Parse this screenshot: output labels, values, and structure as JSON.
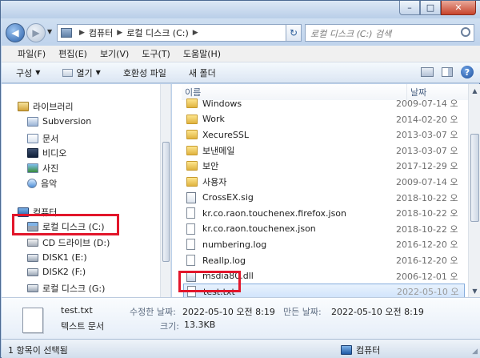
{
  "window": {
    "minimize": "–",
    "maximize": "□",
    "close": "✕"
  },
  "address": {
    "crumbs": [
      "컴퓨터",
      "로컬 디스크 (C:)"
    ],
    "search_placeholder": "로컬 디스크 (C:) 검색"
  },
  "menu": [
    "파일(F)",
    "편집(E)",
    "보기(V)",
    "도구(T)",
    "도움말(H)"
  ],
  "commands": {
    "organize": "구성",
    "open": "열기",
    "compat": "호환성 파일",
    "new_folder": "새 폴더"
  },
  "nav": {
    "libraries": "라이브러리",
    "lib_items": [
      "Subversion",
      "문서",
      "비디오",
      "사진",
      "음악"
    ],
    "computer": "컴퓨터",
    "drives": [
      "로컬 디스크 (C:)",
      "CD 드라이브 (D:)",
      "DISK1 (E:)",
      "DISK2 (F:)",
      "로컬 디스크 (G:)"
    ]
  },
  "list": {
    "col_name": "이름",
    "col_date": "날짜",
    "rows": [
      {
        "name": "Windows",
        "date": "2009-07-14 오",
        "icon": "folder-icon"
      },
      {
        "name": "Work",
        "date": "2014-02-20 오",
        "icon": "folder-icon"
      },
      {
        "name": "XecureSSL",
        "date": "2013-03-07 오",
        "icon": "folder-icon"
      },
      {
        "name": "보낸메일",
        "date": "2013-03-07 오",
        "icon": "folder-icon"
      },
      {
        "name": "보안",
        "date": "2017-12-29 오",
        "icon": "folder-icon"
      },
      {
        "name": "사용자",
        "date": "2009-07-14 오",
        "icon": "folder-icon"
      },
      {
        "name": "CrossEX.sig",
        "date": "2018-10-22 오",
        "icon": "certificate-icon"
      },
      {
        "name": "kr.co.raon.touchenex.firefox.json",
        "date": "2018-10-22 오",
        "icon": "file-icon"
      },
      {
        "name": "kr.co.raon.touchenex.json",
        "date": "2018-10-22 오",
        "icon": "file-icon"
      },
      {
        "name": "numbering.log",
        "date": "2016-12-20 오",
        "icon": "file-icon"
      },
      {
        "name": "Reallp.log",
        "date": "2016-12-20 오",
        "icon": "file-icon"
      },
      {
        "name": "msdia80.dll",
        "date": "2006-12-01 오",
        "icon": "dll-icon"
      },
      {
        "name": "test.txt",
        "date": "2022-05-10 오",
        "icon": "text-file-icon",
        "selected": true
      }
    ]
  },
  "details": {
    "filename": "test.txt",
    "type": "텍스트 문서",
    "modified_label": "수정한 날짜:",
    "modified": "2022-05-10 오전 8:19",
    "created_label": "만든 날짜:",
    "created": "2022-05-10 오전 8:19",
    "size_label": "크기:",
    "size": "13.3KB"
  },
  "status": {
    "selection": "1 항목이 선택됨",
    "location": "컴퓨터"
  },
  "colors": {
    "highlight": "#e2162b",
    "selection": "#cfe3fb"
  }
}
